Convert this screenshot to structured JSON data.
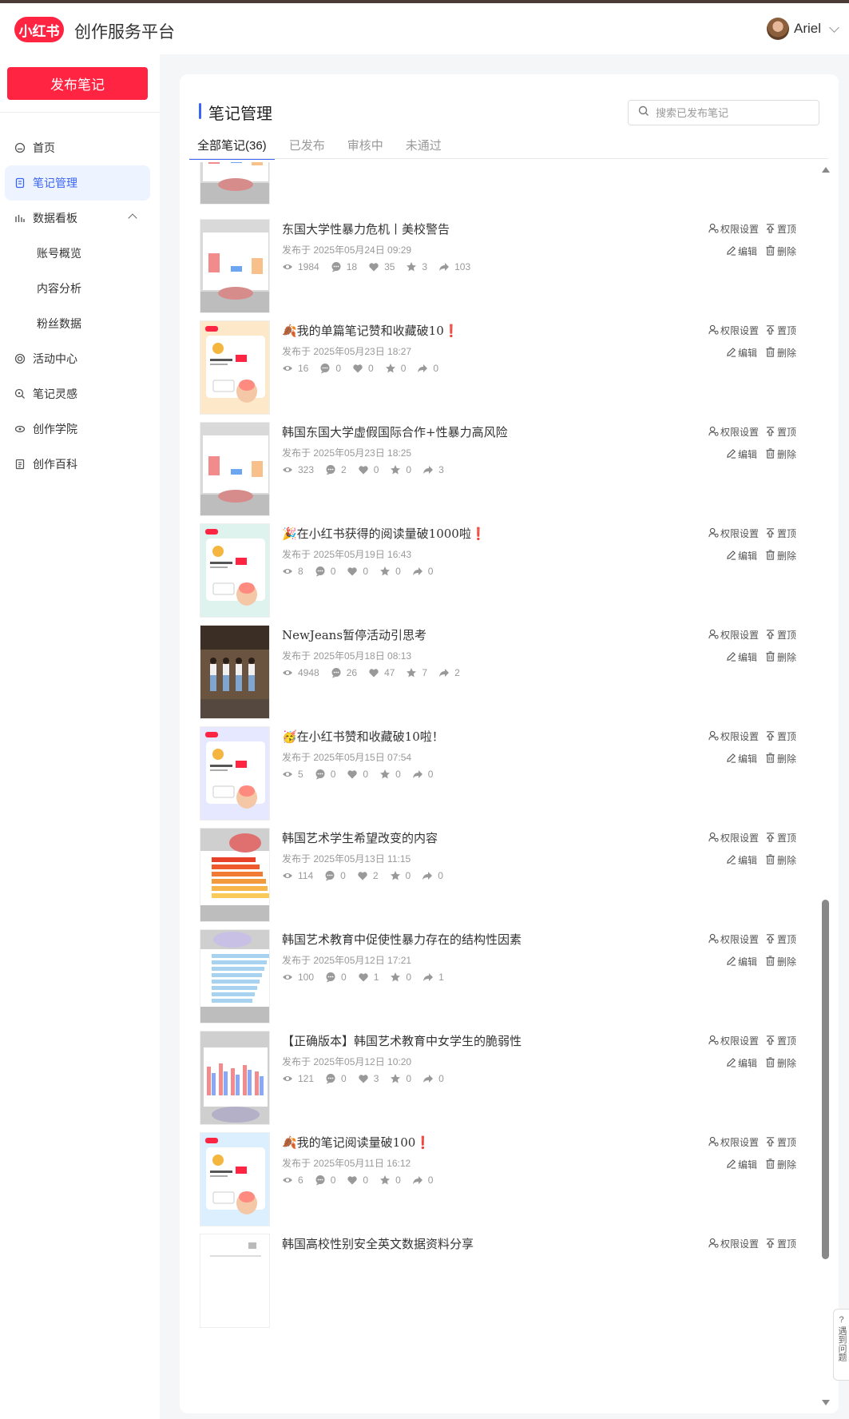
{
  "header": {
    "logo_text": "小红书",
    "brand": "创作服务平台",
    "user_name": "Ariel"
  },
  "sidebar": {
    "publish_label": "发布笔记",
    "items": [
      {
        "label": "首页",
        "icon": "home-icon"
      },
      {
        "label": "笔记管理",
        "icon": "note-icon",
        "active": true
      },
      {
        "label": "数据看板",
        "icon": "bar-chart-icon"
      },
      {
        "label": "账号概览",
        "sub": true
      },
      {
        "label": "内容分析",
        "sub": true
      },
      {
        "label": "粉丝数据",
        "sub": true
      },
      {
        "label": "活动中心",
        "icon": "activity-icon"
      },
      {
        "label": "笔记灵感",
        "icon": "inspiration-icon"
      },
      {
        "label": "创作学院",
        "icon": "academy-icon"
      },
      {
        "label": "创作百科",
        "icon": "wiki-icon"
      }
    ]
  },
  "main": {
    "title": "笔记管理",
    "search_placeholder": "搜索已发布笔记",
    "tabs": [
      {
        "label": "全部笔记(36)",
        "active": true
      },
      {
        "label": "已发布"
      },
      {
        "label": "审核中"
      },
      {
        "label": "未通过"
      }
    ],
    "actions": {
      "permission": "权限设置",
      "pin": "置顶",
      "edit": "编辑",
      "delete": "删除"
    },
    "notes": [
      {
        "title": "东国大学性暴力危机丨美校警告",
        "date": "发布于 2025年05月24日 09:29",
        "views": "1984",
        "comments": "18",
        "likes": "35",
        "collects": "3",
        "shares": "103",
        "thumb": "chart-bars"
      },
      {
        "title": "🍂我的单篇笔记赞和收藏破10❗",
        "date": "发布于 2025年05月23日 18:27",
        "views": "16",
        "comments": "0",
        "likes": "0",
        "collects": "0",
        "shares": "0",
        "thumb": "badge-orange"
      },
      {
        "title": "韩国东国大学虚假国际合作+性暴力高风险",
        "date": "发布于 2025年05月23日 18:25",
        "views": "323",
        "comments": "2",
        "likes": "0",
        "collects": "0",
        "shares": "3",
        "thumb": "chart-bars"
      },
      {
        "title": "🎉在小红书获得的阅读量破1000啦❗",
        "date": "发布于 2025年05月19日 16:43",
        "views": "8",
        "comments": "0",
        "likes": "0",
        "collects": "0",
        "shares": "0",
        "thumb": "badge-green"
      },
      {
        "title": "NewJeans暂停活动引思考",
        "date": "发布于 2025年05月18日 08:13",
        "views": "4948",
        "comments": "26",
        "likes": "47",
        "collects": "7",
        "shares": "2",
        "thumb": "photo"
      },
      {
        "title": "🥳在小红书赞和收藏破10啦！",
        "date": "发布于 2025年05月15日 07:54",
        "views": "5",
        "comments": "0",
        "likes": "0",
        "collects": "0",
        "shares": "0",
        "thumb": "badge-purple"
      },
      {
        "title": "韩国艺术学生希望改变的内容",
        "date": "发布于 2025年05月13日 11:15",
        "views": "114",
        "comments": "0",
        "likes": "2",
        "collects": "0",
        "shares": "0",
        "thumb": "chart-hbars-orange"
      },
      {
        "title": "韩国艺术教育中促使性暴力存在的结构性因素",
        "date": "发布于 2025年05月12日 17:21",
        "views": "100",
        "comments": "0",
        "likes": "1",
        "collects": "0",
        "shares": "1",
        "thumb": "chart-hbars-blue"
      },
      {
        "title": "【正确版本】韩国艺术教育中女学生的脆弱性",
        "date": "发布于 2025年05月12日 10:20",
        "views": "121",
        "comments": "0",
        "likes": "3",
        "collects": "0",
        "shares": "0",
        "thumb": "chart-group"
      },
      {
        "title": "🍂我的笔记阅读量破100❗",
        "date": "发布于 2025年05月11日 16:12",
        "views": "6",
        "comments": "0",
        "likes": "0",
        "collects": "0",
        "shares": "0",
        "thumb": "badge-blue"
      },
      {
        "title": "韩国高校性别安全英文数据资料分享",
        "date": "",
        "views": "",
        "comments": "",
        "likes": "",
        "collects": "",
        "shares": "",
        "thumb": "doc"
      }
    ]
  },
  "help_text": "遇到问题",
  "colors": {
    "brand_red": "#ff2442",
    "accent_blue": "#3a64f8"
  }
}
